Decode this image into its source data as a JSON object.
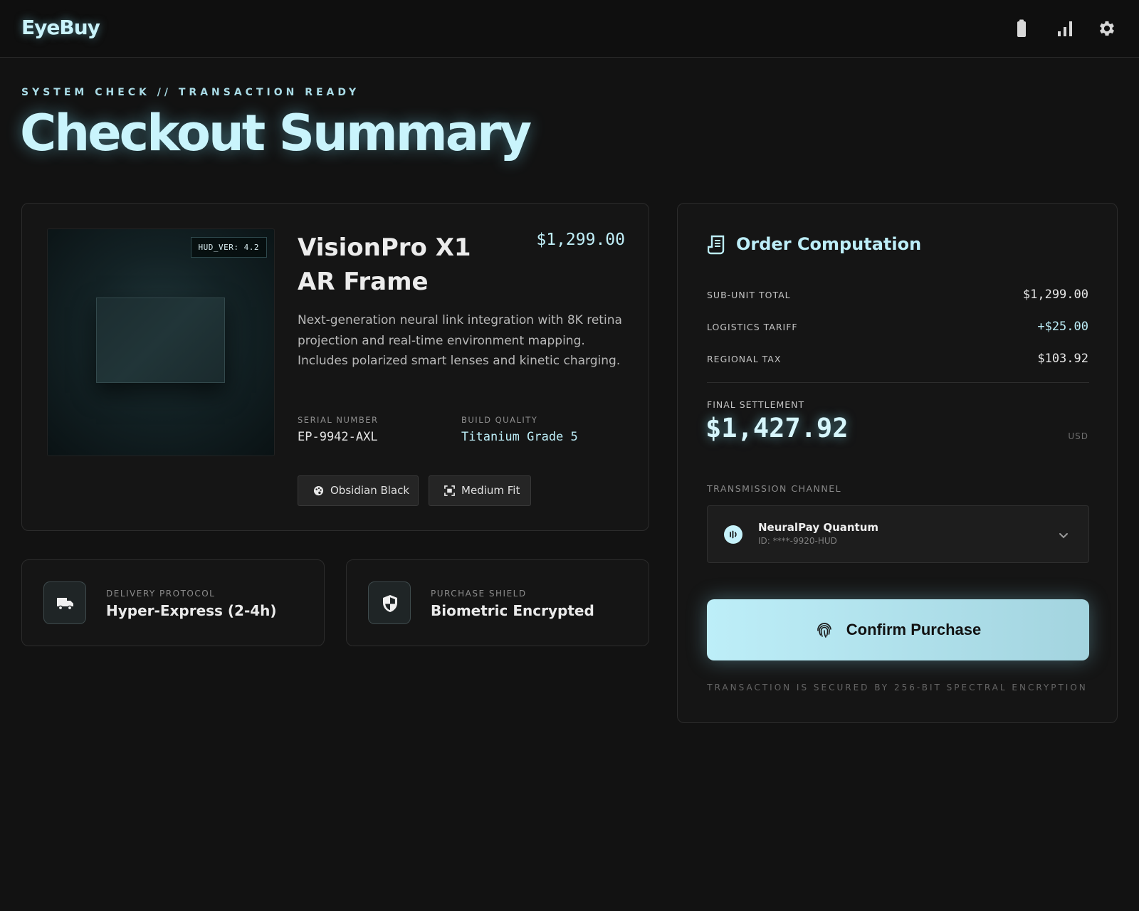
{
  "app": {
    "logo": "EyeBuy"
  },
  "header": {
    "icons": [
      "battery-icon",
      "signal-icon",
      "gear-icon"
    ]
  },
  "page": {
    "kicker": "SYSTEM CHECK // TRANSACTION READY",
    "title": "Checkout Summary"
  },
  "product": {
    "name": "VisionPro X1 AR Frame",
    "price": "$1,299.00",
    "hud_badge": "HUD_VER: 4.2",
    "description": "Next-generation neural link integration with 8K retina projection and real-time environment mapping. Includes polarized smart lenses and kinetic charging.",
    "specs": [
      {
        "label": "SERIAL NUMBER",
        "value": "EP-9942-AXL"
      },
      {
        "label": "BUILD QUALITY",
        "value": "Titanium Grade 5"
      }
    ],
    "options": [
      {
        "label": "Obsidian Black",
        "icon": "palette-icon"
      },
      {
        "label": "Medium Fit",
        "icon": "fit-scan-icon"
      }
    ]
  },
  "info_cards": [
    {
      "label": "DELIVERY PROTOCOL",
      "value": "Hyper-Express (2-4h)",
      "icon": "truck-icon"
    },
    {
      "label": "PURCHASE SHIELD",
      "value": "Biometric Encrypted",
      "icon": "shield-icon"
    }
  ],
  "order": {
    "title": "Order Computation",
    "lines": [
      {
        "label": "SUB-UNIT TOTAL",
        "value": "$1,299.00"
      },
      {
        "label": "LOGISTICS TARIFF",
        "value": "+$25.00"
      },
      {
        "label": "REGIONAL TAX",
        "value": "$103.92"
      }
    ],
    "final_label": "FINAL SETTLEMENT",
    "final_value": "$1,427.92",
    "currency": "USD",
    "channel_label": "TRANSMISSION CHANNEL",
    "payment": {
      "name": "NeuralPay Quantum",
      "id": "ID: ****-9920-HUD"
    },
    "confirm_label": "Confirm Purchase",
    "secure_note": "TRANSACTION IS SECURED BY 256-BIT SPECTRAL ENCRYPTION"
  },
  "colors": {
    "background": "#121212",
    "accent": "#bdeef8",
    "panel": "#151515"
  }
}
